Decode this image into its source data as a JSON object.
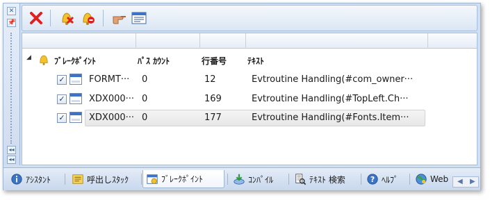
{
  "side": {
    "close_glyph": "✕",
    "pin_glyph": "📌",
    "collapse_glyph": "◂◂"
  },
  "toolbar": {
    "buttons": [
      "delete-icon",
      "breakpoint-remove-icon",
      "breakpoint-clear-icon",
      "goto-source-icon",
      "find-window-icon"
    ]
  },
  "grid": {
    "root": {
      "label": "ﾌﾞﾚｰｸﾎﾟｲﾝﾄ"
    },
    "columns": {
      "pass_count": "ﾊﾟｽ ｶｳﾝﾄ",
      "line": "行番号",
      "text": "ﾃｷｽﾄ"
    },
    "rows": [
      {
        "checked": "✓",
        "name": "FORMT···",
        "pass_count": "0",
        "line": "12",
        "text": "Evtroutine Handling(#com_owner···"
      },
      {
        "checked": "✓",
        "name": "XDX000···",
        "pass_count": "0",
        "line": "169",
        "text": "Evtroutine Handling(#TopLeft.Ch···"
      },
      {
        "checked": "✓",
        "name": "XDX000···",
        "pass_count": "0",
        "line": "177",
        "text": "Evtroutine Handling(#Fonts.Item···"
      }
    ]
  },
  "tabs": [
    {
      "label": "ｱｼｽﾀﾝﾄ",
      "icon": "info-icon"
    },
    {
      "label": "呼出しｽﾀｯｸ",
      "icon": "call-stack-icon"
    },
    {
      "label": "ﾌﾞﾚｰｸﾎﾟｲﾝﾄ",
      "icon": "breakpoint-icon",
      "active": true
    },
    {
      "label": "ｺﾝﾊﾟｲﾙ",
      "icon": "compile-icon"
    },
    {
      "label": "ﾃｷｽﾄ 検索",
      "icon": "text-search-icon"
    },
    {
      "label": "ﾍﾙﾌﾟ",
      "icon": "help-icon"
    },
    {
      "label": "Web",
      "icon": "web-icon"
    }
  ],
  "colors": {
    "accent": "#3d73c4",
    "delete": "#e02020",
    "frame": "#cfe0f4"
  }
}
